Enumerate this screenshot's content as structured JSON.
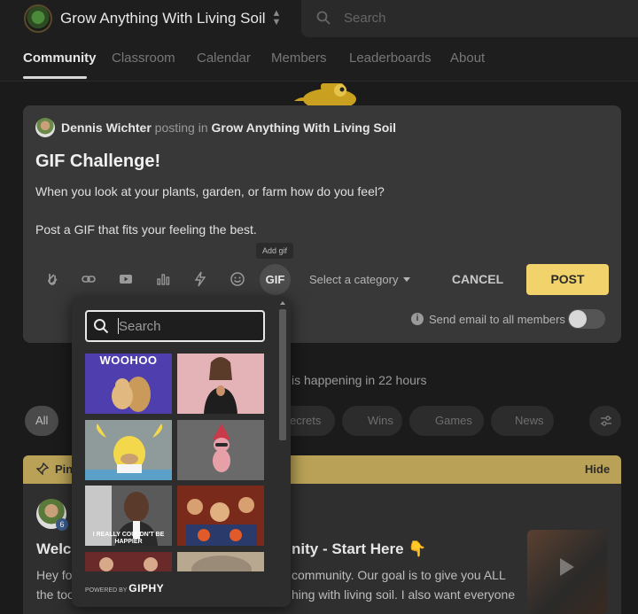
{
  "header": {
    "group_name": "Grow Anything With Living Soil",
    "search_placeholder": "Search",
    "nav": [
      "Community",
      "Classroom",
      "Calendar",
      "Members",
      "Leaderboards",
      "About"
    ]
  },
  "composer": {
    "author": "Dennis Wichter",
    "posting_in": "posting in",
    "group": "Grow Anything With Living Soil",
    "title": "GIF Challenge!",
    "body_line1": "When you look at your plants, garden, or farm how do you feel?",
    "body_line2": "Post a GIF that fits your feeling the best.",
    "gif_tooltip": "Add gif",
    "gif_button": "GIF",
    "category_placeholder": "Select a category",
    "cancel_label": "CANCEL",
    "post_label": "POST",
    "email_label": "Send email to all members",
    "email_toggle_on": false,
    "tools": [
      "attachment-icon",
      "link-icon",
      "video-icon",
      "poll-icon",
      "lightning-icon",
      "emoji-icon"
    ]
  },
  "gif_picker": {
    "search_placeholder": "Search",
    "tiles": [
      {
        "caption": "WOOHOO",
        "bg": "#4f3fae"
      },
      {
        "caption": "",
        "bg": "#e3b3b7"
      },
      {
        "caption": "",
        "bg": "#8f9a9a"
      },
      {
        "caption": "",
        "bg": "#6a6a6a"
      },
      {
        "caption": "I REALLY COULDN'T BE HAPPIER",
        "bg": "#5a5a5a"
      },
      {
        "caption": "",
        "bg": "#a04a2a"
      },
      {
        "caption": "",
        "bg": "#6b2a2a"
      },
      {
        "caption": "",
        "bg": "#b8a890"
      }
    ],
    "powered_by": "POWERED BY",
    "brand": "GIPHY"
  },
  "feed": {
    "event_text": "is happening in 22 hours",
    "chips": [
      "All",
      "ecrets",
      "Wins",
      "Games",
      "News"
    ],
    "pinned_label": "Pin",
    "hide_label": "Hide",
    "avatar_badge": "6",
    "pinned_title_left": "Welc",
    "pinned_title_right": "nity - Start Here 👇",
    "pinned_body_l1a": "Hey fo",
    "pinned_body_l1b": "community. Our goal is to give you ALL",
    "pinned_body_l2a": "the too",
    "pinned_body_l2b": "hing with living soil. I also want everyone"
  },
  "colors": {
    "accent": "#f2d36b",
    "pinned": "#b9a257",
    "panel": "#383838",
    "background": "#1b1b1b"
  }
}
